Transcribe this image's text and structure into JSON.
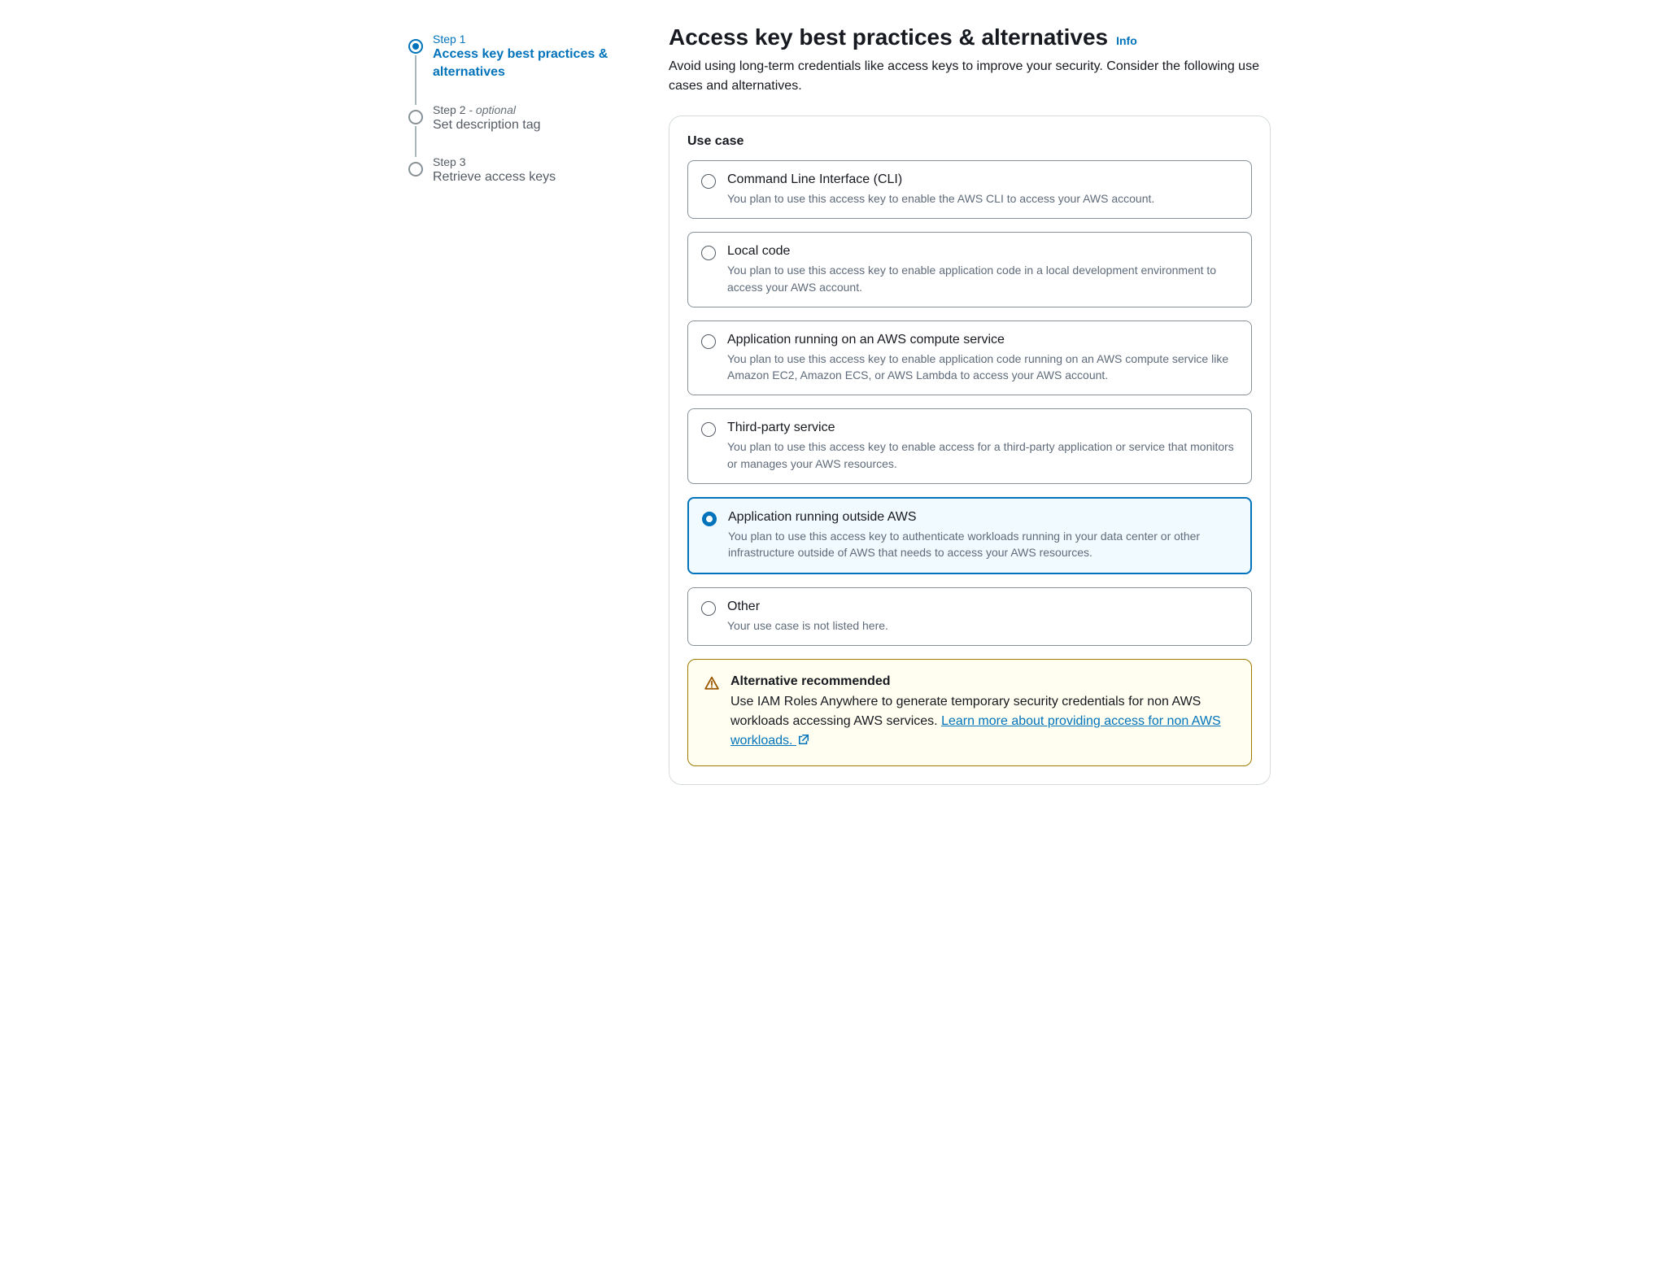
{
  "sidebar": {
    "steps": [
      {
        "label": "Step 1",
        "optional": "",
        "title": "Access key best practices & alternatives",
        "active": true
      },
      {
        "label": "Step 2",
        "optional": "- optional",
        "title": "Set description tag",
        "active": false
      },
      {
        "label": "Step 3",
        "optional": "",
        "title": "Retrieve access keys",
        "active": false
      }
    ]
  },
  "header": {
    "title": "Access key best practices & alternatives",
    "info": "Info",
    "subtitle": "Avoid using long-term credentials like access keys to improve your security. Consider the following use cases and alternatives."
  },
  "panel": {
    "title": "Use case",
    "options": [
      {
        "title": "Command Line Interface (CLI)",
        "desc": "You plan to use this access key to enable the AWS CLI to access your AWS account.",
        "selected": false
      },
      {
        "title": "Local code",
        "desc": "You plan to use this access key to enable application code in a local development environment to access your AWS account.",
        "selected": false
      },
      {
        "title": "Application running on an AWS compute service",
        "desc": "You plan to use this access key to enable application code running on an AWS compute service like Amazon EC2, Amazon ECS, or AWS Lambda to access your AWS account.",
        "selected": false
      },
      {
        "title": "Third-party service",
        "desc": "You plan to use this access key to enable access for a third-party application or service that monitors or manages your AWS resources.",
        "selected": false
      },
      {
        "title": "Application running outside AWS",
        "desc": "You plan to use this access key to authenticate workloads running in your data center or other infrastructure outside of AWS that needs to access your AWS resources.",
        "selected": true
      },
      {
        "title": "Other",
        "desc": "Your use case is not listed here.",
        "selected": false
      }
    ]
  },
  "alert": {
    "title": "Alternative recommended",
    "body_prefix": "Use IAM Roles Anywhere to generate temporary security credentials for non AWS workloads accessing AWS services. ",
    "link_text": "Learn more about providing access for non AWS workloads."
  }
}
